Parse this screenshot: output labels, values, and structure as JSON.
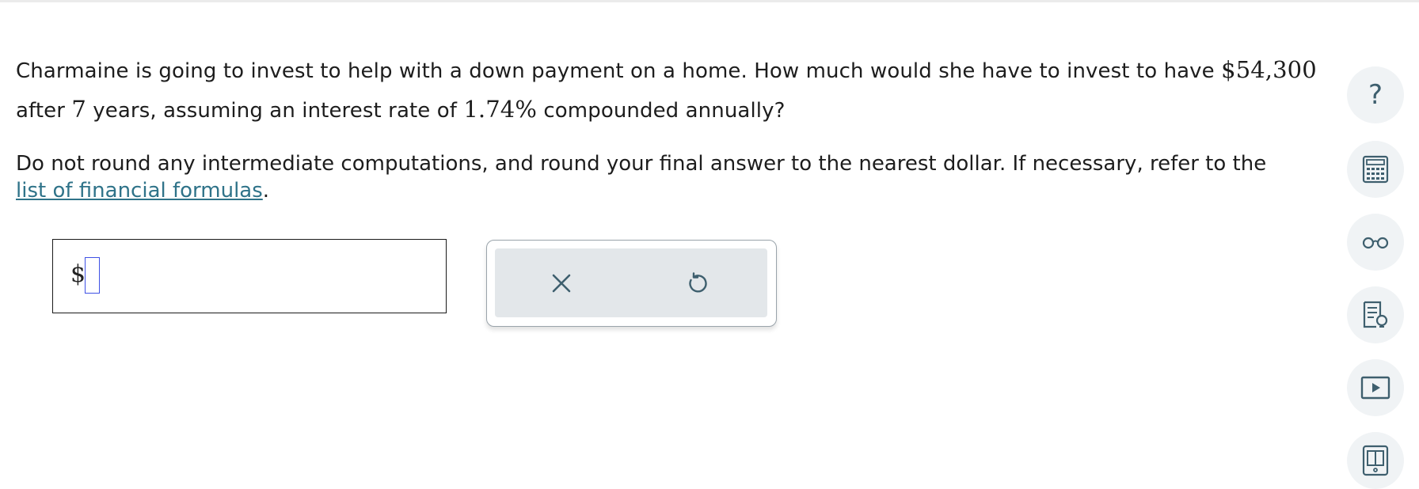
{
  "problem": {
    "line1_text": "Charmaine is going to invest to help with a down payment on a home. How much would she have to invest to have ",
    "amount": "$54,300",
    "line2_prefix": "after ",
    "years": "7",
    "line2_mid": " years, assuming an interest rate of ",
    "rate": "1.74%",
    "line2_suffix": " compounded annually?"
  },
  "instructions": {
    "text": "Do not round any intermediate computations, and round your final answer to the nearest dollar. If necessary, refer to the ",
    "link_label": "list of financial formulas",
    "period": "."
  },
  "answer": {
    "currency_symbol": "$",
    "value": ""
  },
  "actions": {
    "clear_icon": "close-icon",
    "undo_icon": "undo-icon"
  },
  "side_tools": {
    "help": {
      "label": "?",
      "icon": "question-icon"
    },
    "calculator": {
      "icon": "calculator-icon"
    },
    "reader": {
      "icon": "glasses-icon"
    },
    "explanation": {
      "icon": "lightbulb-document-icon"
    },
    "video": {
      "icon": "video-play-icon"
    },
    "ebook": {
      "icon": "book-icon"
    }
  },
  "colors": {
    "link": "#2f7389",
    "input_border": "#3f51e5",
    "tool_bg": "#f0f3f5",
    "icon": "#3e5f6e"
  }
}
